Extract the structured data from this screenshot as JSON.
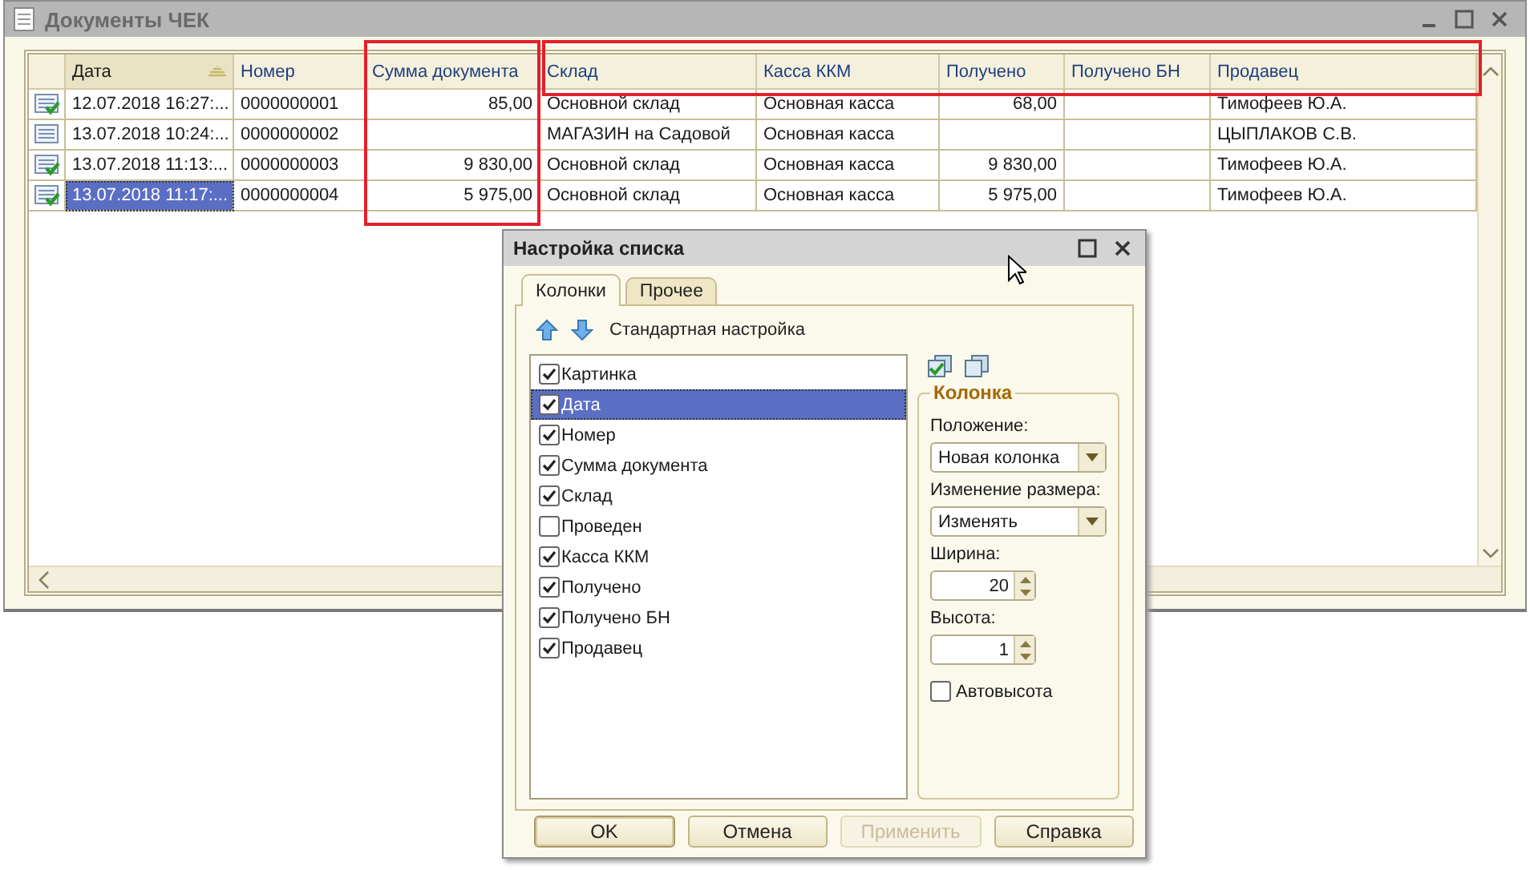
{
  "window": {
    "title": "Документы ЧЕК"
  },
  "table": {
    "columns": [
      {
        "label": "Дата",
        "kind": "text",
        "sorted": true
      },
      {
        "label": "Номер",
        "kind": "text",
        "sorted": false
      },
      {
        "label": "Сумма документа",
        "kind": "number",
        "sorted": false
      },
      {
        "label": "Склад",
        "kind": "text",
        "sorted": false
      },
      {
        "label": "Касса ККМ",
        "kind": "text",
        "sorted": false
      },
      {
        "label": "Получено",
        "kind": "number",
        "sorted": false
      },
      {
        "label": "Получено БН",
        "kind": "number",
        "sorted": false
      },
      {
        "label": "Продавец",
        "kind": "text",
        "sorted": false
      }
    ],
    "rows": [
      {
        "posted": true,
        "selected": false,
        "cells": [
          "12.07.2018 16:27:...",
          "0000000001",
          "85,00",
          "Основной склад",
          "Основная касса",
          "68,00",
          null,
          "Тимофеев Ю.А."
        ]
      },
      {
        "posted": false,
        "selected": false,
        "cells": [
          "13.07.2018 10:24:...",
          "0000000002",
          null,
          "МАГАЗИН на Садовой",
          "Основная касса",
          null,
          null,
          "ЦЫПЛАКОВ С.В."
        ]
      },
      {
        "posted": true,
        "selected": false,
        "cells": [
          "13.07.2018 11:13:...",
          "0000000003",
          "9 830,00",
          "Основной склад",
          "Основная касса",
          "9 830,00",
          null,
          "Тимофеев Ю.А."
        ]
      },
      {
        "posted": true,
        "selected": true,
        "cells": [
          "13.07.2018 11:17:...",
          "0000000004",
          "5 975,00",
          "Основной склад",
          "Основная касса",
          "5 975,00",
          null,
          "Тимофеев Ю.А."
        ]
      }
    ]
  },
  "dialog": {
    "title": "Настройка списка",
    "tabs": [
      {
        "label": "Колонки",
        "selected": true
      },
      {
        "label": "Прочее",
        "selected": false
      }
    ],
    "toolbar_label": "Стандартная настройка",
    "items": [
      {
        "label": "Картинка",
        "checked": true,
        "selected": false
      },
      {
        "label": "Дата",
        "checked": true,
        "selected": true
      },
      {
        "label": "Номер",
        "checked": true,
        "selected": false
      },
      {
        "label": "Сумма документа",
        "checked": true,
        "selected": false
      },
      {
        "label": "Склад",
        "checked": true,
        "selected": false
      },
      {
        "label": "Проведен",
        "checked": false,
        "selected": false
      },
      {
        "label": "Касса ККМ",
        "checked": true,
        "selected": false
      },
      {
        "label": "Получено",
        "checked": true,
        "selected": false
      },
      {
        "label": "Получено БН",
        "checked": true,
        "selected": false
      },
      {
        "label": "Продавец",
        "checked": true,
        "selected": false
      }
    ],
    "group": {
      "title": "Колонка",
      "fields": [
        {
          "kind": "dropdown",
          "label": "Положение:",
          "value": "Новая колонка"
        },
        {
          "kind": "dropdown",
          "label": "Изменение размера:",
          "value": "Изменять"
        },
        {
          "kind": "spinner",
          "label": "Ширина:",
          "value": "20"
        },
        {
          "kind": "spinner",
          "label": "Высота:",
          "value": "1"
        },
        {
          "kind": "checkbox",
          "label": "Автовысота",
          "checked": false
        }
      ]
    },
    "buttons": [
      {
        "label": "OK",
        "disabled": false,
        "default": true
      },
      {
        "label": "Отмена",
        "disabled": false,
        "default": false
      },
      {
        "label": "Применить",
        "disabled": true,
        "default": false
      },
      {
        "label": "Справка",
        "disabled": false,
        "default": false
      }
    ]
  }
}
